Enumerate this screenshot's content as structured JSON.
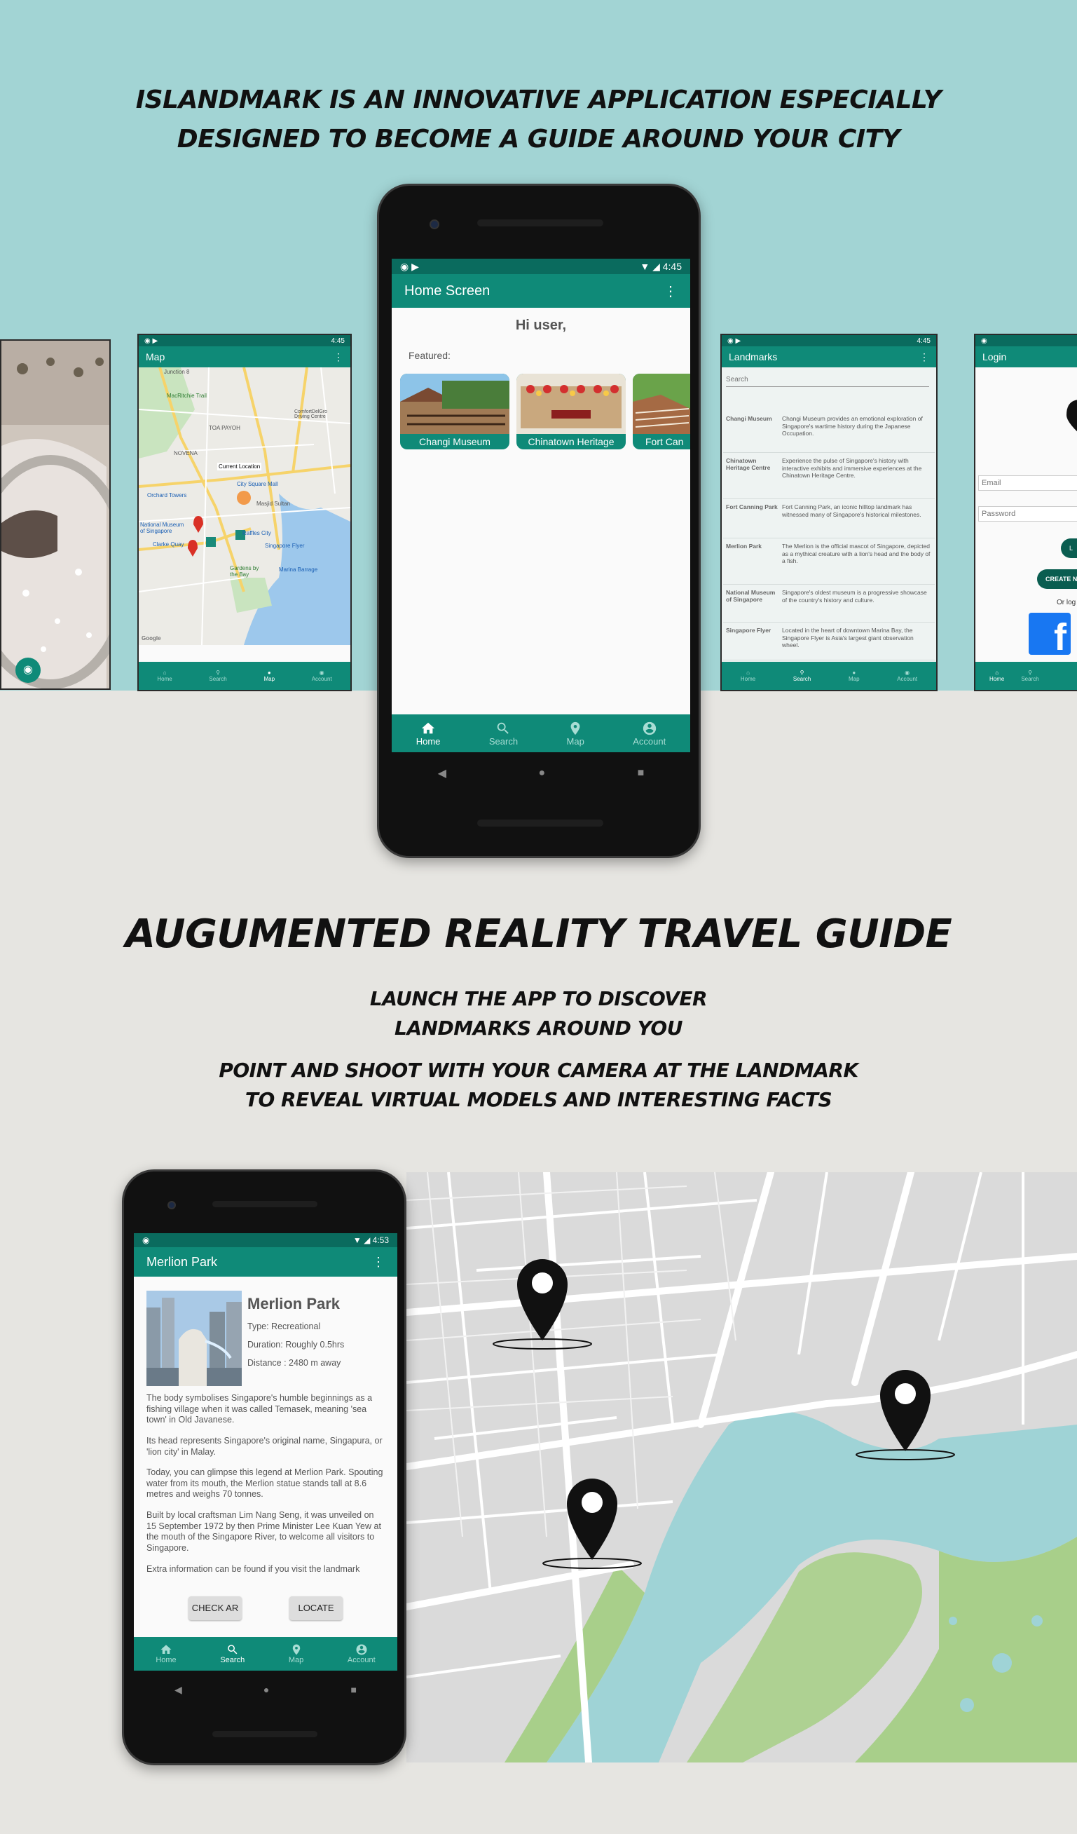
{
  "headline": {
    "line1": "ISLANDMARK IS AN INNOVATIVE APPLICATION ESPECIALLY",
    "line2": "DESIGNED TO BECOME A GUIDE AROUND YOUR CITY"
  },
  "main_phone": {
    "status_time": "4:45",
    "title": "Home Screen",
    "greeting": "Hi user,",
    "featured_label": "Featured:",
    "cards": [
      "Changi Museum",
      "Chinatown Heritage",
      "Fort Can"
    ],
    "nav": [
      "Home",
      "Search",
      "Map",
      "Account"
    ]
  },
  "map_screen": {
    "status_time": "4:45",
    "title": "Map",
    "place_labels": [
      "Junction 8",
      "MacRitchie Trail",
      "TOA PAYOH",
      "ComfortDelGro Driving Centre",
      "NOVENA",
      "Current Location",
      "Orchard Towers",
      "City Square Mall",
      "Masjid Sultan",
      "National Museum of Singapore",
      "Clarke Quay",
      "Raffles City",
      "Singapore Flyer",
      "Gardens by the Bay",
      "Marina Barrage",
      "Google"
    ],
    "nav": [
      "Home",
      "Search",
      "Map",
      "Account"
    ]
  },
  "landmarks_screen": {
    "status_time": "4:45",
    "title": "Landmarks",
    "search_placeholder": "Search",
    "rows": [
      {
        "name": "Changi Museum",
        "desc": "Changi Museum provides an emotional exploration of Singapore's wartime history during the Japanese Occupation."
      },
      {
        "name": "Chinatown Heritage Centre",
        "desc": "Experience the pulse of Singapore's history with interactive exhibits and immersive experiences at the Chinatown Heritage Centre."
      },
      {
        "name": "Fort Canning Park",
        "desc": "Fort Canning Park, an iconic hilltop landmark has witnessed many of Singapore's historical milestones."
      },
      {
        "name": "Merlion Park",
        "desc": "The Merlion is the official mascot of Singapore, depicted as a mythical creature with a lion's head and the body of a fish."
      },
      {
        "name": "National Museum of Singapore",
        "desc": "Singapore's oldest museum is a progressive showcase of the country's history and culture."
      },
      {
        "name": "Singapore Flyer",
        "desc": "Located in the heart of downtown Marina Bay, the Singapore Flyer is Asia's largest giant observation wheel."
      }
    ],
    "nav": [
      "Home",
      "Search",
      "Map",
      "Account"
    ]
  },
  "login_screen": {
    "title": "Login",
    "email_placeholder": "Email",
    "password_placeholder": "Password",
    "login_btn": "L",
    "create_btn": "CREATE N",
    "or_text": "Or log",
    "facebook_glyph": "f",
    "nav": [
      "Home",
      "Search"
    ]
  },
  "section2": {
    "title": "AUGUMENTED REALITY TRAVEL GUIDE",
    "p1_line1": "LAUNCH THE APP TO DISCOVER",
    "p1_line2": "LANDMARKS AROUND YOU",
    "p2_line1": "POINT AND SHOOT WITH YOUR CAMERA AT THE LANDMARK",
    "p2_line2": "TO REVEAL VIRTUAL MODELS AND INTERESTING FACTS"
  },
  "detail_phone": {
    "status_time": "4:53",
    "title": "Merlion Park",
    "place_name": "Merlion Park",
    "type": "Type: Recreational",
    "duration": "Duration: Roughly 0.5hrs",
    "distance": "Distance : 2480 m away",
    "paragraphs": [
      "The body symbolises Singapore's humble beginnings as a fishing village when it was called Temasek, meaning 'sea town' in Old Javanese.",
      "Its head represents Singapore's original name, Singapura, or 'lion city' in Malay.",
      "Today, you can glimpse this legend at Merlion Park. Spouting water from its mouth, the Merlion statue stands tall at 8.6 metres and weighs 70 tonnes.",
      "Built by local craftsman Lim Nang Seng, it was unveiled on 15 September 1972 by then Prime Minister Lee Kuan Yew at the mouth of the Singapore River, to welcome all visitors to Singapore.",
      "Extra information can be found if you visit the landmark"
    ],
    "check_ar": "CHECK AR",
    "locate": "LOCATE",
    "nav": [
      "Home",
      "Search",
      "Map",
      "Account"
    ]
  },
  "colors": {
    "teal_top": "#a2d4d4",
    "app_green": "#0f8a78",
    "status_green": "#0a6b5e",
    "bottom_bg": "#e6e5e1"
  }
}
